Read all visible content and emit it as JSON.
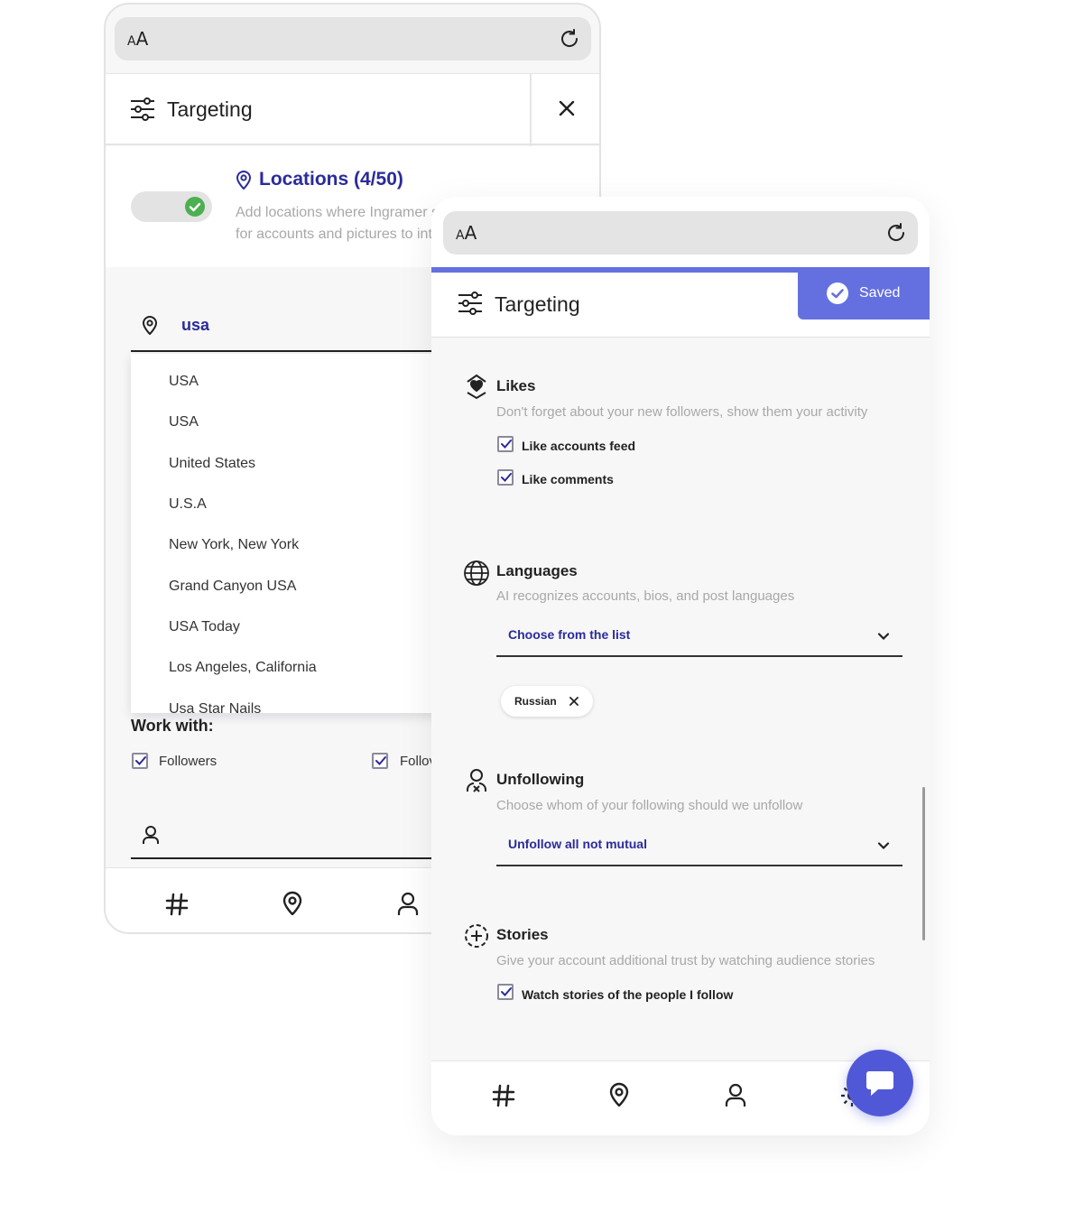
{
  "back_phone": {
    "urlbar": {
      "aa_small": "A",
      "aa_large": "A"
    },
    "header": {
      "title": "Targeting"
    },
    "locations": {
      "title": "Locations (4/50)",
      "description_line1": "Add locations where Ingramer sh",
      "description_line2": "for accounts and pictures to int",
      "toggle_on": true
    },
    "search": {
      "value": "usa"
    },
    "dropdown_options": [
      "USA",
      "USA",
      "United States",
      "U.S.A",
      "New York, New York",
      "Grand Canyon USA",
      "USA Today",
      "Los Angeles, California",
      "Usa Star Nails"
    ],
    "work_with": {
      "label": "Work with:",
      "options": [
        {
          "label": "Followers",
          "checked": true
        },
        {
          "label": "Follov",
          "checked": true
        }
      ]
    }
  },
  "front_phone": {
    "urlbar": {
      "aa_small": "A",
      "aa_large": "A"
    },
    "header": {
      "title": "Targeting",
      "saved_label": "Saved"
    },
    "likes": {
      "title": "Likes",
      "description": "Don't forget about your new followers, show them your activity",
      "options": [
        {
          "label": "Like accounts feed",
          "checked": true
        },
        {
          "label": "Like comments",
          "checked": true
        }
      ]
    },
    "languages": {
      "title": "Languages",
      "description": "AI recognizes accounts, bios, and post languages",
      "select_label": "Choose from the list",
      "chips": [
        "Russian"
      ]
    },
    "unfollowing": {
      "title": "Unfollowing",
      "description": "Choose whom of your following should we unfollow",
      "select_label": "Unfollow all not mutual"
    },
    "stories": {
      "title": "Stories",
      "description": "Give your account additional trust by watching audience stories",
      "options": [
        {
          "label": "Watch stories of the people I follow",
          "checked": true
        }
      ]
    }
  },
  "colors": {
    "accent": "#6470e0",
    "link": "#2b2b9a",
    "toggle_on": "#4caf50",
    "chat": "#5058d8"
  }
}
